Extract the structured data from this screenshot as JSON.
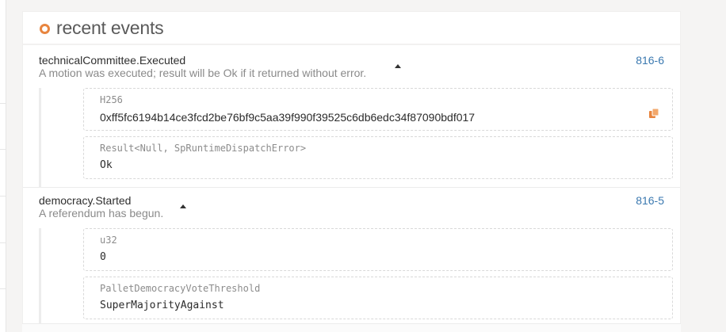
{
  "panel": {
    "title": "recent events"
  },
  "events": [
    {
      "name": "technicalCommittee.Executed",
      "description": "A motion was executed; result will be Ok if it returned without error.",
      "block": "816-6",
      "params": [
        {
          "type": "H256",
          "value": "0xff5fc6194b14ce3fcd2be76bf9c5aa39f990f39525c6db6edc34f87090bdf017"
        },
        {
          "type": "Result<Null, SpRuntimeDispatchError>",
          "value": "Ok"
        }
      ]
    },
    {
      "name": "democracy.Started",
      "description": "A referendum has begun.",
      "block": "816-5",
      "params": [
        {
          "type": "u32",
          "value": "0"
        },
        {
          "type": "PalletDemocracyVoteThreshold",
          "value": "SuperMajorityAgainst"
        }
      ]
    }
  ],
  "colors": {
    "accent": "#e8853f",
    "link": "#3b79b0"
  }
}
